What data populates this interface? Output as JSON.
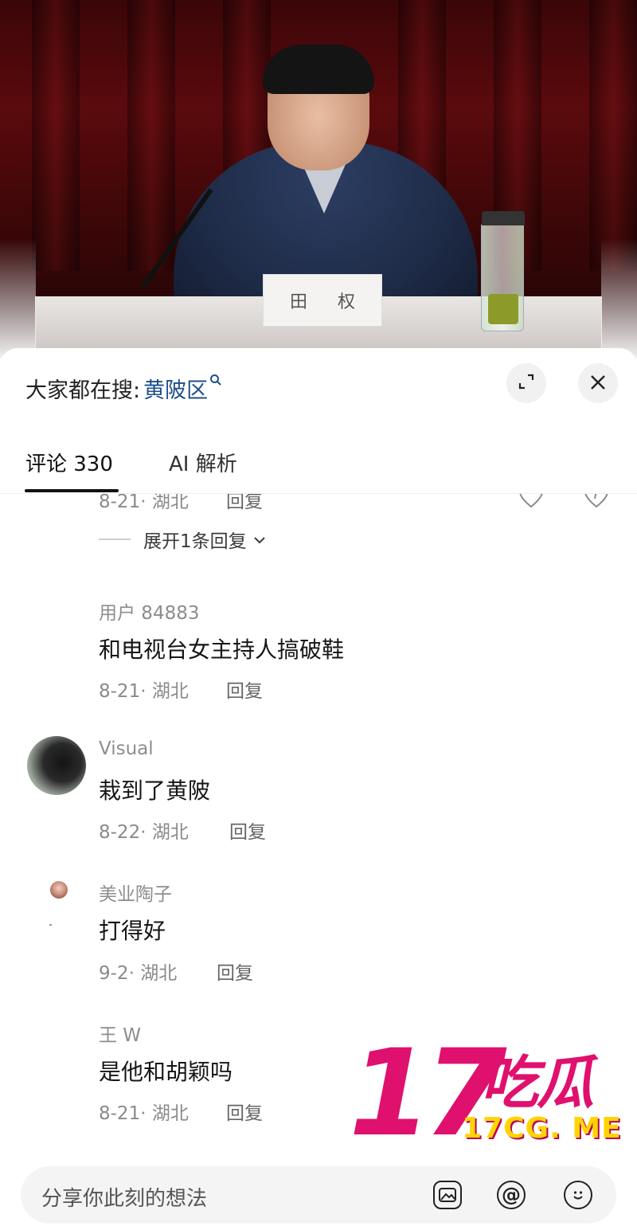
{
  "hero": {
    "nameplate_left": "田",
    "nameplate_right": "权"
  },
  "header": {
    "search_prefix": "大家都在搜:",
    "search_term": "黄陂区",
    "expand_icon": "expand-icon",
    "close_icon": "close-icon"
  },
  "tabs": [
    {
      "label": "评论 330"
    },
    {
      "label": "AI 解析"
    }
  ],
  "partial_comment": {
    "meta": "8-21· 湖北",
    "reply": "回复"
  },
  "expand_replies": {
    "label": "展开1条回复"
  },
  "comments": [
    {
      "user": "用户 84883",
      "text": "和电视台女主持人搞破鞋",
      "meta": "8-21· 湖北",
      "reply": "回复"
    },
    {
      "user": "Visual",
      "text": "栽到了黄陂",
      "meta": "8-22· 湖北",
      "reply": "回复"
    },
    {
      "user": "美业陶子",
      "text": "打得好",
      "meta": "9-2· 湖北",
      "reply": "回复"
    },
    {
      "user": "王 W",
      "text": "是他和胡颖吗",
      "meta": "8-21· 湖北",
      "reply": "回复"
    }
  ],
  "watermark": {
    "number": "17",
    "cn": "吃瓜",
    "url": "17CG. ME"
  },
  "input": {
    "placeholder": "分享你此刻的想法"
  }
}
